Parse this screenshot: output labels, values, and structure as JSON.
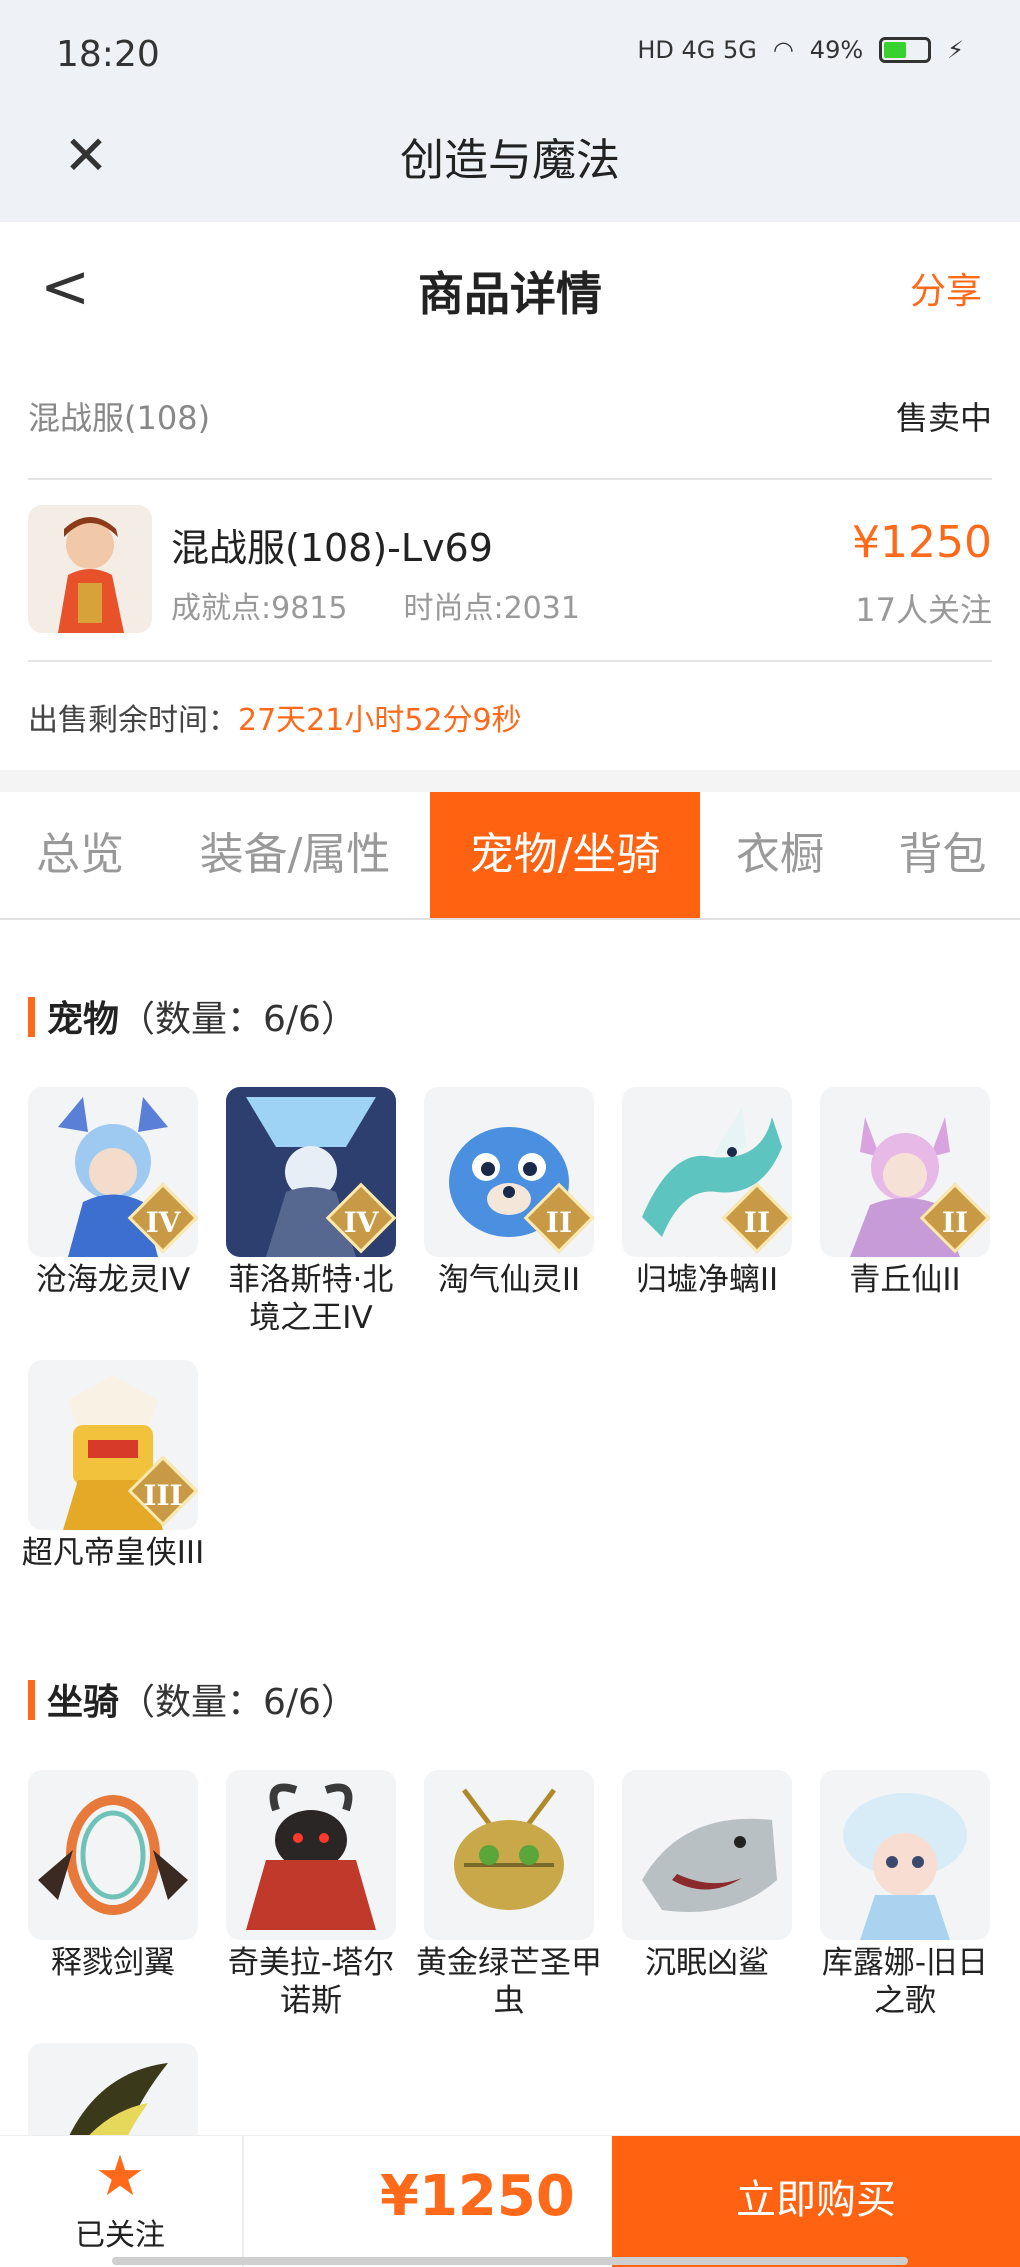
{
  "status_bar": {
    "time": "18:20",
    "network": "HD 4G 5G",
    "battery": "49%"
  },
  "app_bar": {
    "title": "创造与魔法"
  },
  "page_header": {
    "title": "商品详情",
    "share": "分享"
  },
  "listing": {
    "server": "混战服(108)",
    "status": "售卖中",
    "name": "混战服(108)-Lv69",
    "achievement": "成就点:9815",
    "fashion": "时尚点:2031",
    "price": "¥1250",
    "followers": "17人关注",
    "remain_label": "出售剩余时间：",
    "remain_value": "27天21小时52分9秒"
  },
  "tabs": [
    {
      "label": "总览"
    },
    {
      "label": "装备/属性"
    },
    {
      "label": "宠物/坐骑",
      "active": true
    },
    {
      "label": "衣橱"
    },
    {
      "label": "背包"
    }
  ],
  "pets": {
    "title": "宠物",
    "count": "（数量：6/6）",
    "items": [
      {
        "label": "沧海龙灵IV",
        "badge": "IV",
        "color": "#9ec9f0"
      },
      {
        "label": "菲洛斯特·北境之王IV",
        "badge": "IV",
        "color": "#6a86b8"
      },
      {
        "label": "淘气仙灵II",
        "badge": "II",
        "color": "#4b8fe0"
      },
      {
        "label": "归墟净螭II",
        "badge": "II",
        "color": "#5ec4c0"
      },
      {
        "label": "青丘仙II",
        "badge": "II",
        "color": "#e7b9e6"
      },
      {
        "label": "超凡帝皇侠III",
        "badge": "III",
        "color": "#f2c23c"
      }
    ]
  },
  "mounts": {
    "title": "坐骑",
    "count": "（数量：6/6）",
    "items": [
      {
        "label": "释戮剑翼",
        "color": "#e77a3a"
      },
      {
        "label": "奇美拉-塔尔诺斯",
        "color": "#c0392b"
      },
      {
        "label": "黄金绿芒圣甲虫",
        "color": "#c9a84a"
      },
      {
        "label": "沉眠凶鲨",
        "color": "#b9c0c4"
      },
      {
        "label": "库露娜-旧日之歌",
        "color": "#a9d3ee"
      }
    ]
  },
  "bottom_bar": {
    "follow_label": "已关注",
    "price": "¥1250",
    "buy_label": "立即购买"
  }
}
